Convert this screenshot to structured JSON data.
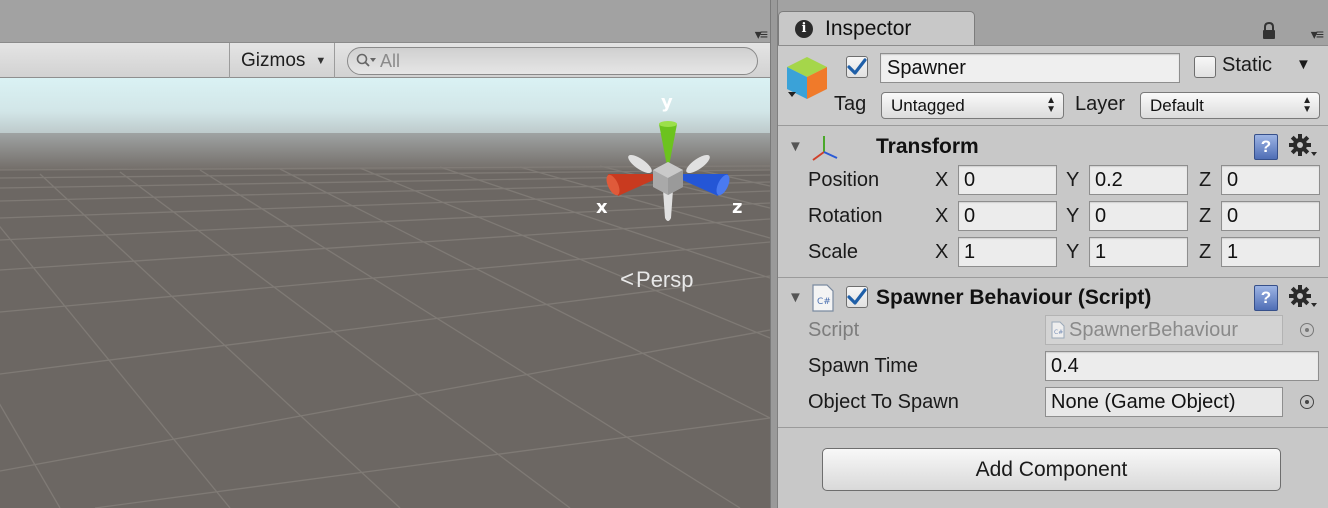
{
  "scene": {
    "toolbar": {
      "gizmos_label": "Gizmos",
      "gizmos_caret": "▼",
      "search_placeholder": "All"
    },
    "gizmo_axes": {
      "x": "x",
      "y": "y",
      "z": "z"
    },
    "projection_label": "Persp"
  },
  "inspector": {
    "tab_label": "Inspector",
    "game_object": {
      "active": true,
      "name": "Spawner",
      "static_label": "Static",
      "static": false,
      "tag_label": "Tag",
      "tag_value": "Untagged",
      "layer_label": "Layer",
      "layer_value": "Default"
    },
    "transform": {
      "title": "Transform",
      "rows": [
        {
          "label": "Position",
          "x": "0",
          "y": "0.2",
          "z": "0"
        },
        {
          "label": "Rotation",
          "x": "0",
          "y": "0",
          "z": "0"
        },
        {
          "label": "Scale",
          "x": "1",
          "y": "1",
          "z": "1"
        }
      ],
      "axis_x": "X",
      "axis_y": "Y",
      "axis_z": "Z"
    },
    "script_component": {
      "enabled": true,
      "title": "Spawner Behaviour (Script)",
      "script_label": "Script",
      "script_value": "SpawnerBehaviour",
      "spawn_time_label": "Spawn Time",
      "spawn_time_value": "0.4",
      "object_label": "Object To Spawn",
      "object_value": "None (Game Object)"
    },
    "add_component_label": "Add Component",
    "help_glyph": "?",
    "info_glyph": "i"
  },
  "colors": {
    "inspector_bg": "#c8c8c8",
    "checkbox_tick": "#1f5fa8",
    "gizmo_x": "#c93a1f",
    "gizmo_y": "#6cc31e",
    "gizmo_z": "#2456d6"
  }
}
